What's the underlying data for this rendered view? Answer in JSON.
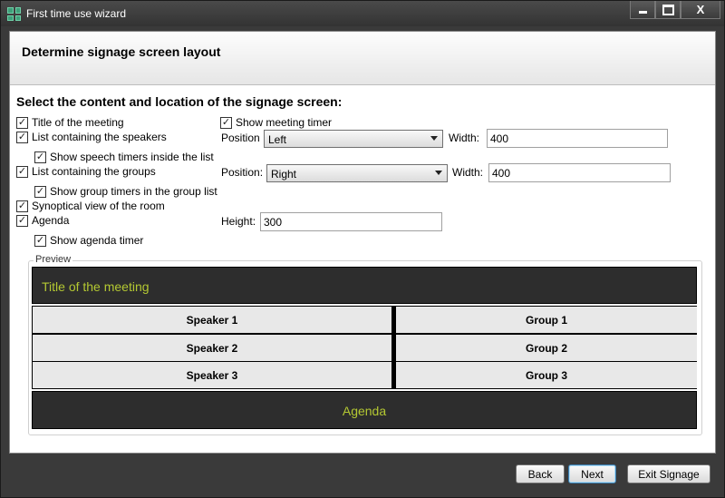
{
  "window": {
    "title": "First time use wizard",
    "close_glyph": "X"
  },
  "header": {
    "title": "Determine signage screen layout"
  },
  "section": {
    "title": "Select the content and location of the signage screen:"
  },
  "options": {
    "title_of_meeting": {
      "label": "Title of the meeting",
      "checked": true
    },
    "show_meeting_timer": {
      "label": "Show meeting timer",
      "checked": true
    },
    "speakers_list": {
      "label": "List containing the speakers",
      "checked": true
    },
    "speech_timers": {
      "label": "Show speech timers inside the list",
      "checked": true
    },
    "groups_list": {
      "label": "List containing the groups",
      "checked": true
    },
    "group_timers": {
      "label": "Show group timers in the group list",
      "checked": true
    },
    "synoptical_view": {
      "label": "Synoptical view of the room",
      "checked": true
    },
    "agenda": {
      "label": "Agenda",
      "checked": true
    },
    "agenda_timer": {
      "label": "Show agenda timer",
      "checked": true
    }
  },
  "speakers_settings": {
    "position_label": "Position",
    "position_value": "Left",
    "width_label": "Width:",
    "width_value": "400"
  },
  "groups_settings": {
    "position_label": "Position:",
    "position_value": "Right",
    "width_label": "Width:",
    "width_value": "400"
  },
  "agenda_settings": {
    "height_label": "Height:",
    "height_value": "300"
  },
  "check_glyph": "✓",
  "preview": {
    "legend": "Preview",
    "title": "Title of the meeting",
    "speakers": [
      "Speaker 1",
      "Speaker 2",
      "Speaker 3"
    ],
    "groups": [
      "Group 1",
      "Group 2",
      "Group 3"
    ],
    "agenda": "Agenda",
    "accent_color": "#b4c832"
  },
  "footer": {
    "back_label": "Back",
    "next_label": "Next",
    "exit_label": "Exit Signage"
  }
}
